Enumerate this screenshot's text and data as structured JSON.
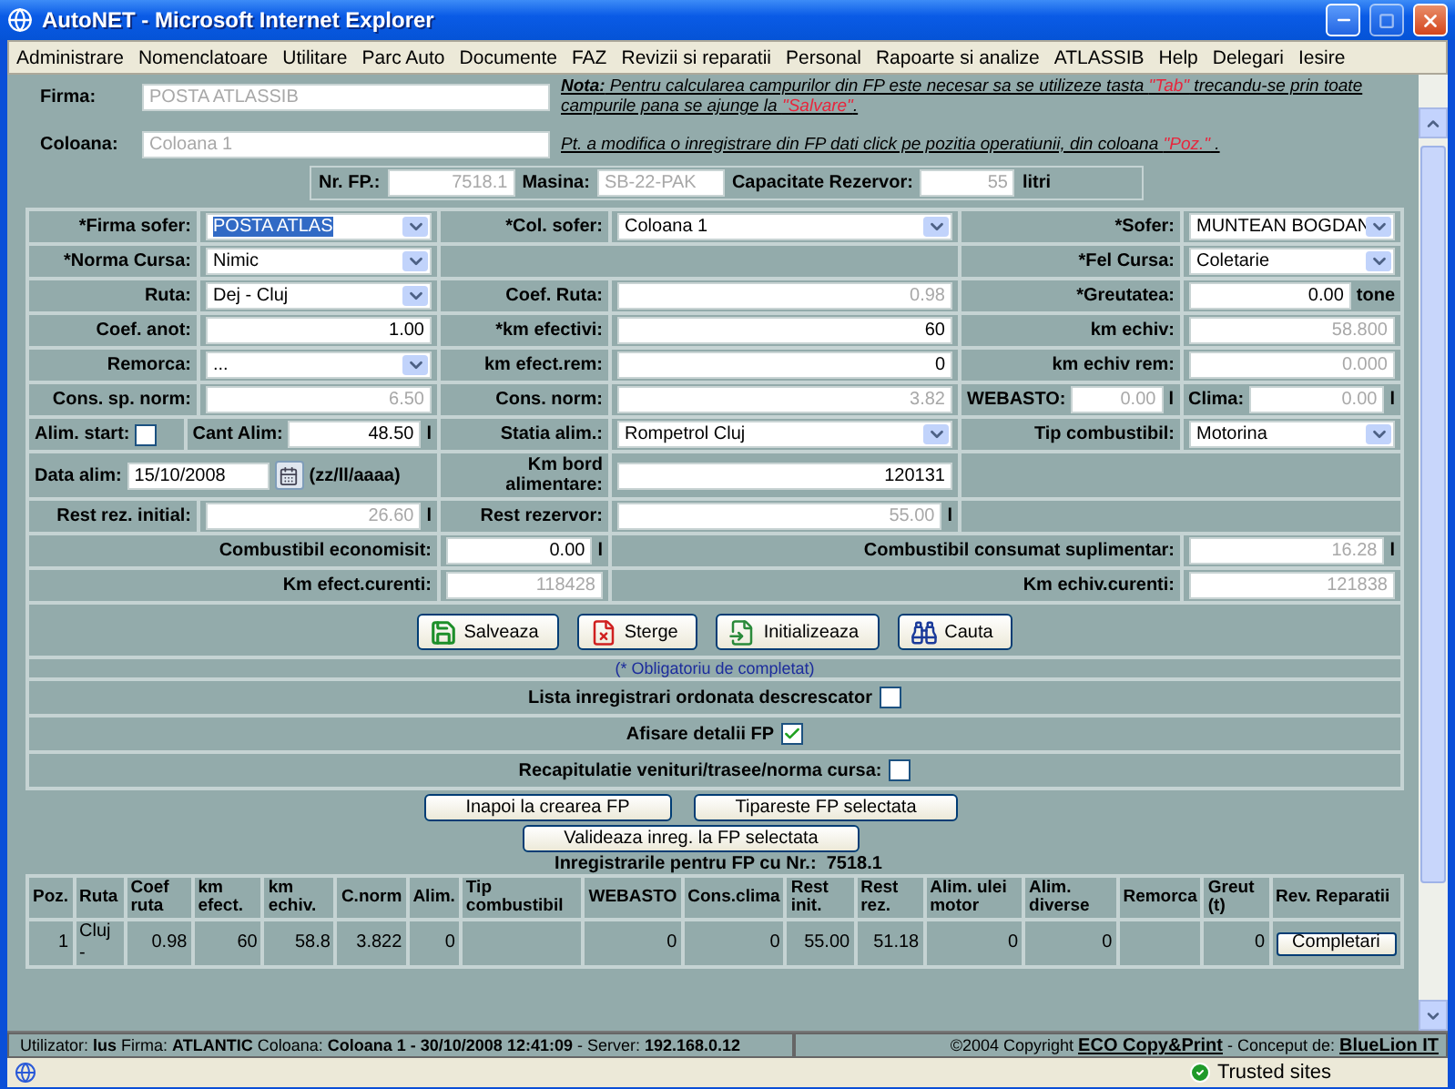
{
  "window": {
    "title": "AutoNET - Microsoft Internet Explorer"
  },
  "menu": [
    "Administrare",
    "Nomenclatoare",
    "Utilitare",
    "Parc Auto",
    "Documente",
    "FAZ",
    "Revizii si reparatii",
    "Personal",
    "Rapoarte si analize",
    "ATLASSIB",
    "Help",
    "Delegari",
    "Iesire"
  ],
  "header": {
    "fields": [
      {
        "label": "Firma:",
        "value": "POSTA ATLASSIB"
      },
      {
        "label": "Coloana:",
        "value": "Coloana 1"
      }
    ],
    "notes": [
      [
        {
          "t": "Nota:",
          "kind": "bold"
        },
        {
          "t": " Pentru calcularea campurilor din FP este necesar sa se utilizeze tasta ",
          "kind": "plain"
        },
        {
          "t": "\"Tab\"",
          "kind": "key"
        },
        {
          "t": " trecandu-se prin toate campurile pana se ajunge la ",
          "kind": "plain"
        },
        {
          "t": "\"Salvare\"",
          "kind": "key"
        },
        {
          "t": ".",
          "kind": "plain"
        }
      ],
      [
        {
          "t": "Pt. a modifica o inregistrare din FP dati click pe pozitia operatiunii, din coloana ",
          "kind": "plain"
        },
        {
          "t": "\"Poz.\"",
          "kind": "key"
        },
        {
          "t": " .",
          "kind": "plain"
        }
      ]
    ],
    "nr_fp": [
      {
        "label": "Nr. FP.:",
        "value": "7518.1"
      },
      {
        "label": "Masina:",
        "value": "SB-22-PAK"
      },
      {
        "label": "Capacitate Rezervor:",
        "value": "55",
        "unit": "litri"
      }
    ]
  },
  "form": {
    "rows": [
      {
        "cells": [
          {
            "label": "*Firma sofer:",
            "kind": "select",
            "value": "POSTA ATLAS",
            "focused": true
          },
          {
            "label": "*Col. sofer:",
            "kind": "select",
            "value": "Coloana 1",
            "focused": false
          },
          {
            "label": "*Sofer:",
            "kind": "select",
            "value": "MUNTEAN BOGDAN",
            "focused": false
          }
        ]
      },
      {
        "cells": [
          {
            "label": "*Norma Cursa:",
            "kind": "select",
            "value": "Nimic",
            "focused": false
          },
          null,
          {
            "label": "*Fel Cursa:",
            "kind": "select",
            "value": "Coletarie",
            "focused": false
          }
        ]
      },
      {
        "cells": [
          {
            "label": "Ruta:",
            "kind": "select",
            "value": "Dej - Cluj",
            "focused": false
          },
          {
            "label": "Coef. Ruta:",
            "kind": "input",
            "value": "0.98",
            "disabled": true
          },
          {
            "label": "*Greutatea:",
            "kind": "input",
            "value": "0.00",
            "disabled": false,
            "unit": "tone"
          }
        ]
      },
      {
        "cells": [
          {
            "label": "Coef. anot:",
            "kind": "input",
            "value": "1.00",
            "disabled": false
          },
          {
            "label": "*km efectivi:",
            "kind": "input",
            "value": "60",
            "disabled": false
          },
          {
            "label": "km echiv:",
            "kind": "input",
            "value": "58.800",
            "disabled": true
          }
        ]
      },
      {
        "cells": [
          {
            "label": "Remorca:",
            "kind": "select",
            "value": "...",
            "focused": false
          },
          {
            "label": "km efect.rem:",
            "kind": "input",
            "value": "0",
            "disabled": false
          },
          {
            "label": "km echiv rem:",
            "kind": "input",
            "value": "0.000",
            "disabled": true
          }
        ]
      },
      {
        "cells": [
          {
            "label": "Cons. sp. norm:",
            "kind": "input",
            "value": "6.50",
            "disabled": true
          },
          {
            "label": "Cons. norm:",
            "kind": "input",
            "value": "3.82",
            "disabled": true
          },
          {
            "kind": "split",
            "parts": [
              {
                "label": "WEBASTO:",
                "kind": "input",
                "value": "0.00",
                "disabled": true,
                "unit": "l"
              },
              {
                "label": "Clima:",
                "kind": "input",
                "value": "0.00",
                "disabled": true,
                "unit": "l"
              }
            ]
          }
        ]
      },
      {
        "cells": [
          {
            "kind": "split",
            "parts": [
              {
                "label": "Alim. start:",
                "kind": "checkbox",
                "checked": false
              },
              {
                "label": "Cant Alim:",
                "kind": "input",
                "value": "48.50",
                "disabled": false,
                "unit": "l"
              }
            ]
          },
          {
            "label": "Statia alim.:",
            "kind": "select",
            "value": "Rompetrol Cluj",
            "focused": false
          },
          {
            "label": "Tip combustibil:",
            "kind": "select",
            "value": "Motorina",
            "focused": false
          }
        ]
      },
      {
        "cells": [
          {
            "label": "Data alim:",
            "kind": "date",
            "value": "15/10/2008",
            "format": "(zz/ll/aaaa)"
          },
          {
            "label": "Km bord alimentare:",
            "kind": "input",
            "value": "120131",
            "disabled": false
          },
          null
        ]
      },
      {
        "cells": [
          {
            "label": "Rest rez. initial:",
            "kind": "input",
            "value": "26.60",
            "disabled": true,
            "unit": "l"
          },
          {
            "label": "Rest rezervor:",
            "kind": "input",
            "value": "55.00",
            "disabled": true,
            "unit": "l"
          },
          null
        ]
      }
    ],
    "totals": [
      [
        {
          "label": "Combustibil economisit:",
          "value": "0.00",
          "disabled": false,
          "unit": "l"
        },
        {
          "label": "Combustibil consumat suplimentar:",
          "value": "16.28",
          "disabled": true,
          "unit": "l"
        }
      ],
      [
        {
          "label": "Km efect.curenti:",
          "value": "118428",
          "disabled": true
        },
        {
          "label": "Km echiv.curenti:",
          "value": "121838",
          "disabled": true
        }
      ]
    ]
  },
  "actions": [
    {
      "label": "Salveaza",
      "kind": "save"
    },
    {
      "label": "Sterge",
      "kind": "delete"
    },
    {
      "label": "Initializeaza",
      "kind": "reset"
    },
    {
      "label": "Cauta",
      "kind": "search"
    }
  ],
  "required_note": "(* Obligatoriu de completat)",
  "options": [
    {
      "label": "Lista inregistrari ordonata descrescator",
      "checked": false
    },
    {
      "label": "Afisare detalii FP",
      "checked": true
    },
    {
      "label": "Recapitulatie venituri/trasee/norma cursa:",
      "checked": false
    }
  ],
  "nav_buttons": [
    [
      "Inapoi la crearea FP",
      "Tipareste FP selectata"
    ],
    [
      "Valideaza inreg. la FP selectata"
    ]
  ],
  "records": {
    "title": "Inregistrarile pentru FP cu Nr.:",
    "number": "7518.1",
    "columns": [
      "Poz.",
      "Ruta",
      "Coef ruta",
      "km efect.",
      "km echiv.",
      "C.norm",
      "Alim.",
      "Tip combustibil",
      "WEBASTO",
      "Cons.clima",
      "Rest init.",
      "Rest rez.",
      "Alim. ulei motor",
      "Alim. diverse",
      "Remorca",
      "Greut (t)",
      "Rev. Reparatii"
    ],
    "rows": [
      {
        "cells": [
          "1",
          "Cluj -",
          "0.98",
          "60",
          "58.8",
          "3.822",
          "0",
          null,
          "0",
          "0",
          "55.00",
          "51.18",
          "0",
          "0",
          null,
          "0"
        ],
        "action": "Completari"
      }
    ]
  },
  "status": {
    "left": "Utilizator: **lus** Firma: **ATLANTIC** Coloana: **Coloana 1 - 30/10/2008 12:41:09** - Server: **192.168.0.12**",
    "right": [
      {
        "t": "©2004 Copyright ",
        "kind": "plain"
      },
      {
        "t": "ECO Copy&Print",
        "kind": "link"
      },
      {
        "t": " - Conceput de: ",
        "kind": "plain"
      },
      {
        "t": "BlueLion IT",
        "kind": "link"
      }
    ]
  },
  "ie_status": {
    "zone": "Trusted sites"
  }
}
